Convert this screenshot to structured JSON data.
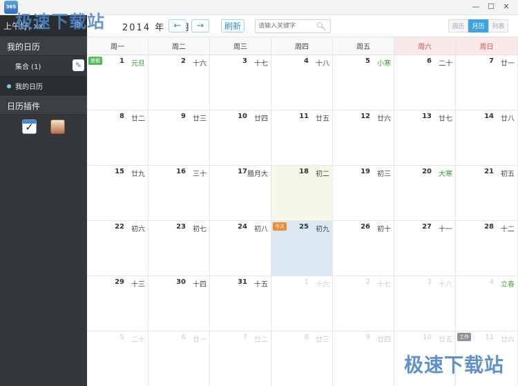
{
  "app": {
    "logo_text": "365"
  },
  "titlebar": {
    "controls": [
      "—",
      "☐",
      "✕"
    ]
  },
  "sidebar": {
    "header_text": "上午好, xx",
    "section_my_calendar": "我的日历",
    "items": [
      {
        "label": "集合 (1)"
      },
      {
        "label": "我的日历"
      }
    ],
    "section_plugins": "日历插件"
  },
  "toolbar": {
    "month_label": "2014 年 1 月",
    "prev_label": "←",
    "next_label": "→",
    "refresh_label": "刷新",
    "search_placeholder": "请输入关键字",
    "views": [
      "周历",
      "月历",
      "列表"
    ],
    "active_view": "月历"
  },
  "calendar": {
    "weekdays": [
      "周一",
      "周二",
      "周三",
      "周四",
      "周五",
      "周六",
      "周日"
    ],
    "days": [
      {
        "d": "1",
        "l": "元旦",
        "term": true,
        "badge": "放假",
        "badge_type": "holiday"
      },
      {
        "d": "2",
        "l": "十六"
      },
      {
        "d": "3",
        "l": "十七"
      },
      {
        "d": "4",
        "l": "十八"
      },
      {
        "d": "5",
        "l": "小寒",
        "term": true
      },
      {
        "d": "6",
        "l": "二十"
      },
      {
        "d": "7",
        "l": "廿一"
      },
      {
        "d": "8",
        "l": "廿二"
      },
      {
        "d": "9",
        "l": "廿三"
      },
      {
        "d": "10",
        "l": "廿四"
      },
      {
        "d": "11",
        "l": "廿五"
      },
      {
        "d": "12",
        "l": "廿六"
      },
      {
        "d": "13",
        "l": "廿七"
      },
      {
        "d": "14",
        "l": "廿八"
      },
      {
        "d": "15",
        "l": "廿九"
      },
      {
        "d": "16",
        "l": "三十"
      },
      {
        "d": "17",
        "l": "腊月大"
      },
      {
        "d": "18",
        "l": "初二",
        "state": "selected"
      },
      {
        "d": "19",
        "l": "初三"
      },
      {
        "d": "20",
        "l": "大寒",
        "term": true
      },
      {
        "d": "21",
        "l": "初五"
      },
      {
        "d": "22",
        "l": "初六"
      },
      {
        "d": "23",
        "l": "初七"
      },
      {
        "d": "24",
        "l": "初八"
      },
      {
        "d": "25",
        "l": "初九",
        "state": "today",
        "badge": "今天",
        "badge_type": "today"
      },
      {
        "d": "26",
        "l": "初十"
      },
      {
        "d": "27",
        "l": "十一"
      },
      {
        "d": "28",
        "l": "十二"
      },
      {
        "d": "29",
        "l": "十三"
      },
      {
        "d": "30",
        "l": "十四"
      },
      {
        "d": "31",
        "l": "十五"
      },
      {
        "d": "1",
        "l": "十六",
        "other": true
      },
      {
        "d": "2",
        "l": "十七",
        "other": true
      },
      {
        "d": "3",
        "l": "十八",
        "other": true
      },
      {
        "d": "4",
        "l": "立春",
        "other": true,
        "term": true
      },
      {
        "d": "5",
        "l": "二十",
        "other": true
      },
      {
        "d": "6",
        "l": "廿一",
        "other": true
      },
      {
        "d": "7",
        "l": "廿二",
        "other": true
      },
      {
        "d": "8",
        "l": "廿三",
        "other": true
      },
      {
        "d": "9",
        "l": "廿四",
        "other": true
      },
      {
        "d": "10",
        "l": "廿五",
        "other": true
      },
      {
        "d": "11",
        "l": "廿六",
        "other": true,
        "badge": "工作",
        "badge_type": "work"
      }
    ]
  },
  "watermark": {
    "text": "极速下载站"
  },
  "colors": {
    "accent": "#3fa3e3",
    "sidebar_bg": "#34373b",
    "weekend_header": "#fbe9e9",
    "today_bg": "#dbe9f5",
    "selected_bg": "#f7f7e8",
    "solar_term": "#3b9a3b"
  }
}
